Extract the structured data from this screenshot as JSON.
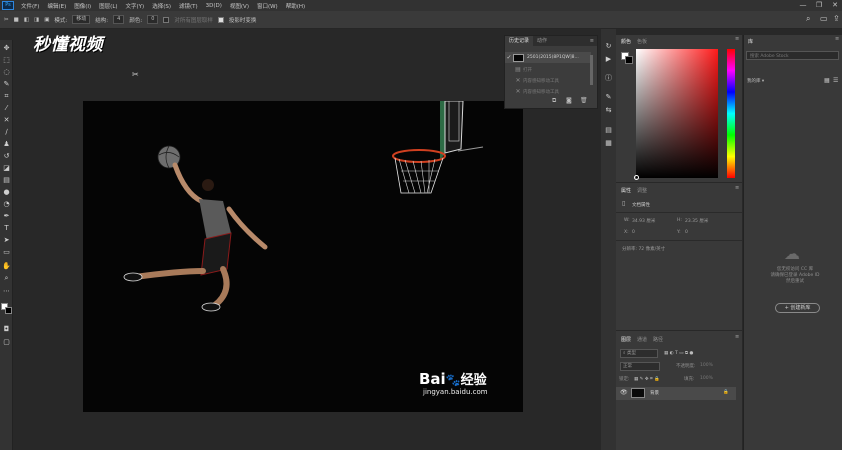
{
  "menubar": {
    "logo": "Ps",
    "items": [
      "文件(F)",
      "编辑(E)",
      "图像(I)",
      "图层(L)",
      "文字(Y)",
      "选择(S)",
      "滤镜(T)",
      "3D(D)",
      "视图(V)",
      "窗口(W)",
      "帮助(H)"
    ]
  },
  "window": {
    "minimize": "—",
    "restore": "❐",
    "close": "✕"
  },
  "optionsbar": {
    "mode_label": "模式:",
    "mode_value": "移动",
    "structure_label": "结构:",
    "structure_value": "4",
    "color_label": "颜色:",
    "color_value": "0",
    "sample_all": "对所有图层取样",
    "transform_on_drop": "投影时变换"
  },
  "watermark_top": "秒懂视频",
  "history": {
    "tabs": [
      "历史记录",
      "动作"
    ],
    "snapshot": "2501(2015)8P1QW]8...",
    "items": [
      "打开",
      "内容感知移动工具",
      "内容感知移动工具"
    ]
  },
  "color": {
    "tabs": [
      "颜色",
      "色板"
    ],
    "foreground": "#ffffff",
    "background": "#000000"
  },
  "properties": {
    "tabs": [
      "属性",
      "调整"
    ],
    "doc_title": "文档属性",
    "w_label": "W:",
    "w_value": "34.93 厘米",
    "h_label": "H:",
    "h_value": "23.35 厘米",
    "x_label": "X:",
    "x_value": "0",
    "y_label": "Y:",
    "y_value": "0",
    "resolution": "分辨率: 72 像素/英寸"
  },
  "layers": {
    "tabs": [
      "图层",
      "通道",
      "路径"
    ],
    "filter": "类型",
    "blend": "正常",
    "opacity_label": "不透明度:",
    "opacity": "100%",
    "lock_label": "锁定:",
    "fill_label": "填充:",
    "fill": "100%",
    "layer_name": "背景"
  },
  "libraries": {
    "tab": "库",
    "search_placeholder": "搜索 Adobe Stock",
    "dropdown": "我的库",
    "message": [
      "您无权访问 CC 库",
      "请确保已登录 Adobe ID",
      "然后重试"
    ],
    "create_button": "+ 创建新库"
  },
  "canvas_watermark": {
    "brand_text": "Bai",
    "brand_cn": "经验",
    "url": "jingyan.baidu.com"
  }
}
